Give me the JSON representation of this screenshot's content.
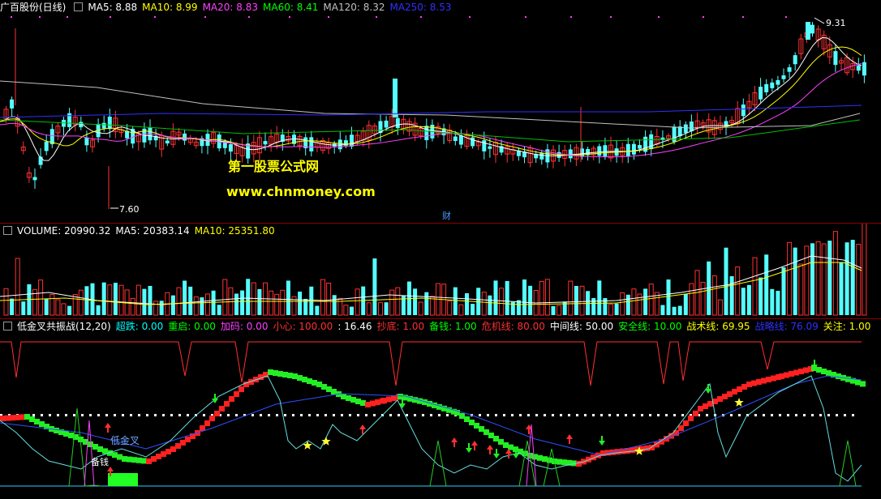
{
  "price_panel": {
    "stock_title": "广百股份(日线)",
    "ma_labels": [
      {
        "text": "MA5: 8.88",
        "color": "#ffffff"
      },
      {
        "text": "MA10: 8.99",
        "color": "#ffff00"
      },
      {
        "text": "MA20: 8.83",
        "color": "#ff40ff"
      },
      {
        "text": "MA60: 8.41",
        "color": "#00ff00"
      },
      {
        "text": "MA120: 8.32",
        "color": "#c0c0c0"
      },
      {
        "text": "MA250: 8.53",
        "color": "#3030ff"
      }
    ],
    "high_label": "9.31",
    "low_label": "7.60",
    "fin_marker": "财",
    "watermark_title": "第一股票公式网",
    "watermark_url": "www.chnmoney.com"
  },
  "volume_panel": {
    "labels": [
      {
        "text": "VOLUME: 20990.32",
        "color": "#ffffff"
      },
      {
        "text": "MA5: 20383.14",
        "color": "#ffffff"
      },
      {
        "text": "MA10: 25351.80",
        "color": "#ffff00"
      }
    ]
  },
  "indicator_panel": {
    "name": "低金叉共振战(12,20)",
    "labels": [
      {
        "text": "超跌: 0.00",
        "color": "#00ffff"
      },
      {
        "text": "重启: 0.00",
        "color": "#00ff00"
      },
      {
        "text": "加码: 0.00",
        "color": "#ff40ff"
      },
      {
        "text": "小心: 100.00",
        "color": "#ff3030"
      },
      {
        "text": ": 16.46",
        "color": "#ffffff"
      },
      {
        "text": "抄底: 1.00",
        "color": "#ff3030"
      },
      {
        "text": "备钱: 1.00",
        "color": "#00ff00"
      },
      {
        "text": "危机线: 80.00",
        "color": "#ff3030"
      },
      {
        "text": "中间线: 50.00",
        "color": "#ffffff"
      },
      {
        "text": "安全线: 10.00",
        "color": "#00ff00"
      },
      {
        "text": "战术线: 69.95",
        "color": "#ffff00"
      },
      {
        "text": "战略线: 76.09",
        "color": "#3030ff"
      },
      {
        "text": "关注: 1.00",
        "color": "#ffff00"
      }
    ],
    "annotations": {
      "golden_cross": "低金叉",
      "reserve": "备钱"
    }
  },
  "colors": {
    "up": "#ff3232",
    "down": "#54ffff",
    "divider": "#8b0000"
  }
}
